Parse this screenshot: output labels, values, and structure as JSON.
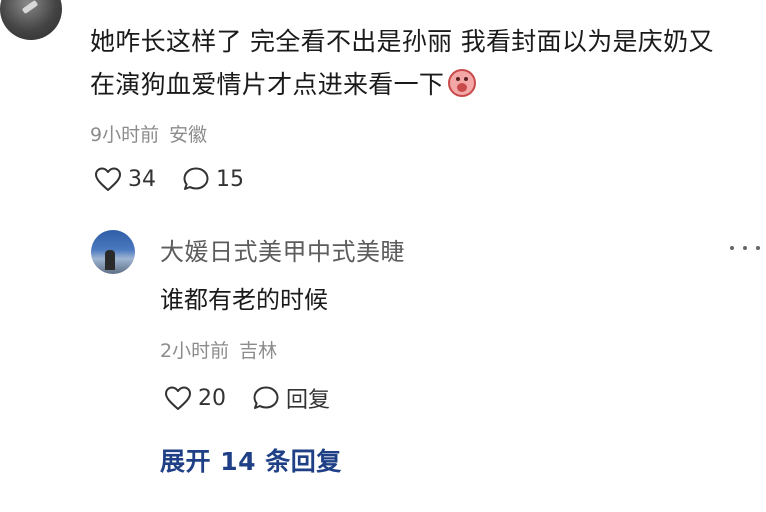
{
  "top_comment": {
    "text": "她咋长这样了 完全看不出是孙丽 我看封面以为是庆奶又在演狗血爱情片才点进来看一下",
    "time": "9小时前",
    "location": "安徽",
    "like_count": "34",
    "comment_count": "15"
  },
  "reply": {
    "username": "大媛日式美甲中式美睫",
    "text": "谁都有老的时候",
    "time": "2小时前",
    "location": "吉林",
    "like_count": "20",
    "reply_label": "回复"
  },
  "expand_replies": "展开 14 条回复",
  "icons": {
    "like": "heart-outline-icon",
    "comment": "speech-bubble-icon",
    "more": "more-dots-icon",
    "emoji": "crying-face-emoji"
  },
  "colors": {
    "link": "#1f3f86",
    "meta": "#8c8c8c",
    "text": "#1a1a1a"
  }
}
